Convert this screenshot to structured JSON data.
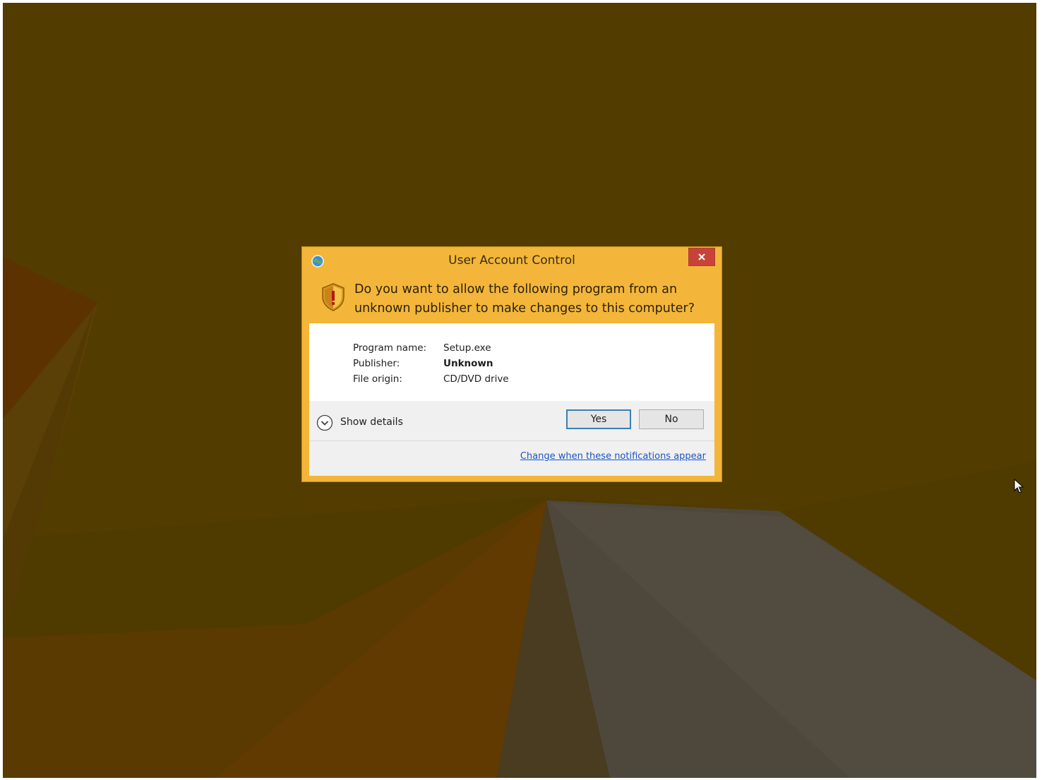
{
  "dialog": {
    "title": "User Account Control",
    "question": "Do you want to allow the following program from an unknown publisher to make changes to this computer?",
    "details": [
      {
        "label": "Program name:",
        "value": "Setup.exe"
      },
      {
        "label": "Publisher:",
        "value": "Unknown"
      },
      {
        "label": "File origin:",
        "value": "CD/DVD drive"
      }
    ],
    "show_details_label": "Show details",
    "yes_label": "Yes",
    "no_label": "No",
    "change_notifications_link": "Change when these notifications appear"
  },
  "colors": {
    "desktop_background": "#4f3a00",
    "dialog_frame": "#f3b63a",
    "close_button": "#c7433a",
    "link": "#1a56c6",
    "default_button_border": "#3c7fb1"
  },
  "icons": {
    "title_icon": "uac-globe-icon",
    "dialog_icon": "shield-warning-icon",
    "close": "close-icon",
    "expand": "chevron-down-icon",
    "pointer": "mouse-cursor-icon"
  }
}
